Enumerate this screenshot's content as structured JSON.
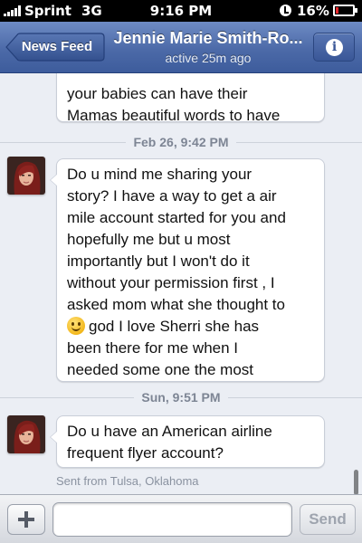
{
  "status_bar": {
    "carrier": "Sprint",
    "network": "3G",
    "time": "9:16 PM",
    "battery": "16%",
    "battery_level": 0.16,
    "battery_color": "#e3262b",
    "icons": [
      "signal-bars-icon",
      "alarm-clock-icon",
      "battery-icon"
    ]
  },
  "nav": {
    "back_label": "News Feed",
    "title": "Jennie Marie Smith-Ro...",
    "subtitle": "active 25m ago",
    "info_icon": "i"
  },
  "messages": [
    {
      "text": "your babies can have their\nMamas beautiful words to have"
    },
    {
      "date": "Feb 26, 9:42 PM",
      "text_before_emoji": "Do u mind me sharing your\nstory? I have a way to get a air\nmile account started for you and\nhopefully me but u most\nimportantly but I won't do it\nwithout your permission  first , I\nasked mom what she thought to\n",
      "emoji": "smiling-face-icon",
      "text_after_emoji": "god I love Sherri she has\nbeen there for me when I\nneeded some one the most"
    },
    {
      "date": "Sun, 9:51 PM",
      "text": "Do u have an American airline\nfrequent flyer account?",
      "sent_from": "Sent from Tulsa, Oklahoma"
    }
  ],
  "composer": {
    "placeholder": "",
    "send_label": "Send"
  },
  "colors": {
    "nav_blue": "#4c6aa8",
    "background": "#ebeef4"
  }
}
